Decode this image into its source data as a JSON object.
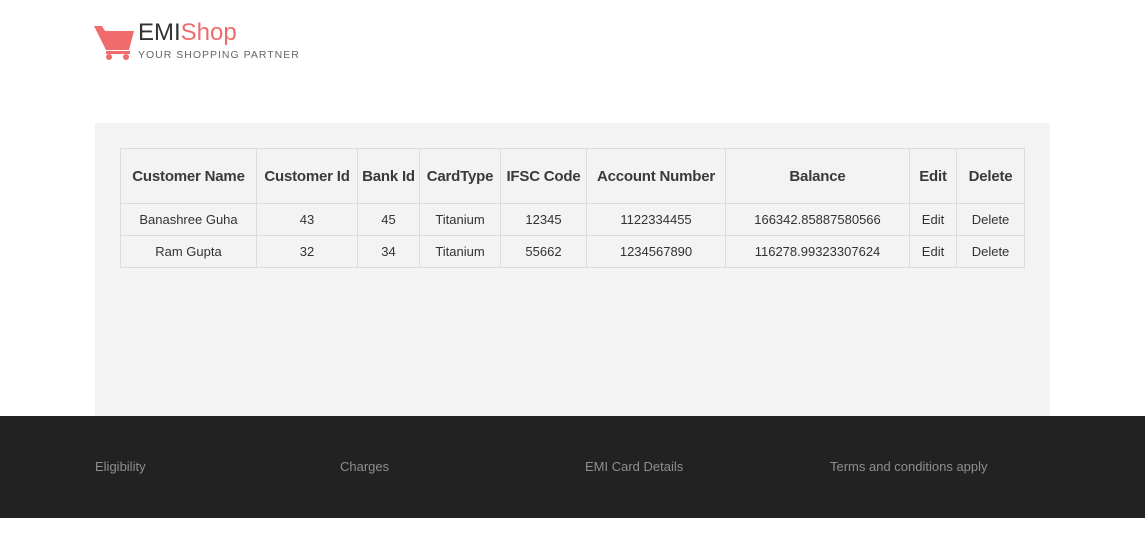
{
  "brand": {
    "name_part1": "EMI",
    "name_part2": "Shop",
    "tagline": "YOUR SHOPPING PARTNER",
    "accent_color": "#f06b6b",
    "logo_icon": "shopping-cart-icon"
  },
  "table": {
    "headers": [
      "Customer Name",
      "Customer Id",
      "Bank Id",
      "CardType",
      "IFSC Code",
      "Account Number",
      "Balance",
      "Edit",
      "Delete"
    ],
    "rows": [
      {
        "customer_name": "Banashree Guha",
        "customer_id": "43",
        "bank_id": "45",
        "card_type": "Titanium",
        "ifsc_code": "12345",
        "account_number": "1122334455",
        "balance": "166342.85887580566",
        "edit": "Edit",
        "delete": "Delete"
      },
      {
        "customer_name": "Ram Gupta",
        "customer_id": "32",
        "bank_id": "34",
        "card_type": "Titanium",
        "ifsc_code": "55662",
        "account_number": "1234567890",
        "balance": "116278.99323307624",
        "edit": "Edit",
        "delete": "Delete"
      }
    ]
  },
  "footer": {
    "links": [
      "Eligibility",
      "Charges",
      "EMI Card Details",
      "Terms and conditions apply"
    ],
    "background_color": "#222222"
  }
}
